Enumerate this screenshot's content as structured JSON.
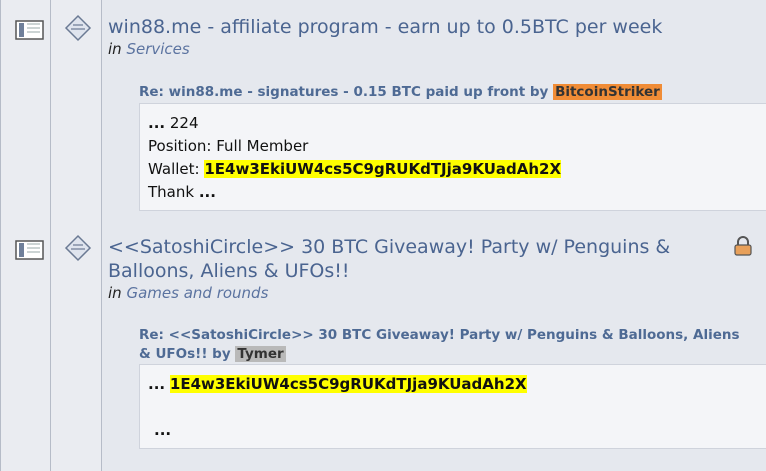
{
  "topics": [
    {
      "title": "win88.me - affiliate program - earn up to 0.5BTC per week",
      "in_label": "in",
      "board": "Services",
      "reply_title": "Re: win88.me - signatures - 0.15 BTC paid up front by",
      "reply_author": "BitcoinStriker",
      "author_color": "#f08c36",
      "lines": {
        "l1_prefix": "...",
        "l1_text": "224",
        "l2": "Position: Full Member",
        "l3_prefix": "Wallet:",
        "l3_wallet": "1E4w3EkiUW4cs5C9gRUKdTJja9KUadAh2X",
        "l4_text": "Thank",
        "l4_suffix": "..."
      },
      "locked": false
    },
    {
      "title": "<<SatoshiCircle>> 30 BTC Giveaway! Party w/ Penguins & Balloons, Aliens & UFOs!!",
      "in_label": "in",
      "board": "Games and rounds",
      "reply_title": "Re: <<SatoshiCircle>> 30 BTC Giveaway! Party w/ Penguins & Balloons, Aliens & UFOs!! by",
      "reply_author": "Tymer",
      "author_color": "#b9b9b9",
      "lines": {
        "l1_prefix": "...",
        "l1_wallet": "1E4w3EkiUW4cs5C9gRUKdTJja9KUadAh2X",
        "l2": "...",
        "icon": "lock-icon"
      },
      "locked": true
    }
  ],
  "icons": {
    "topic_icon": "topic-icon",
    "post_icon": "post-icon",
    "lock_icon": "lock-icon"
  },
  "colors": {
    "highlight": "#ffff00",
    "link": "#4a6490"
  }
}
